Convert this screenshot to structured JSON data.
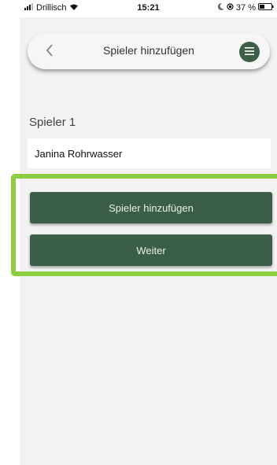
{
  "status_bar": {
    "carrier": "Drillisch",
    "time": "15:21",
    "battery": "37 %"
  },
  "header": {
    "title": "Spieler hinzufügen"
  },
  "player": {
    "label": "Spieler 1",
    "name_value": "Janina Rohrwasser"
  },
  "actions": {
    "add_player_label": "Spieler hinzufügen",
    "next_label": "Weiter"
  },
  "colors": {
    "accent_green": "#3b5e48",
    "highlight_green": "#8dcd40"
  }
}
